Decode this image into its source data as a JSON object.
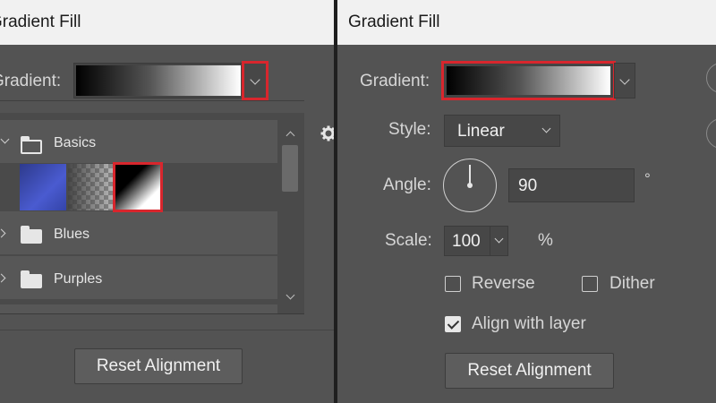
{
  "left_panel": {
    "title": "Gradient Fill",
    "gradient_label": "Gradient:",
    "folders": [
      {
        "label": "Basics",
        "expanded": true
      },
      {
        "label": "Blues",
        "expanded": false
      },
      {
        "label": "Purples",
        "expanded": false
      }
    ],
    "reset_button": "Reset Alignment"
  },
  "right_panel": {
    "title": "Gradient Fill",
    "gradient_label": "Gradient:",
    "style_label": "Style:",
    "style_value": "Linear",
    "angle_label": "Angle:",
    "angle_value": "90",
    "angle_unit": "°",
    "scale_label": "Scale:",
    "scale_value": "100",
    "scale_unit": "%",
    "reverse_label": "Reverse",
    "dither_label": "Dither",
    "align_label": "Align with layer",
    "reverse_checked": false,
    "dither_checked": false,
    "align_checked": true,
    "reset_button": "Reset Alignment"
  },
  "colors": {
    "panel_bg": "#535353",
    "title_bg": "#f1f1f1",
    "highlight_red": "#d8262d",
    "divider": "#1f1f1f"
  }
}
